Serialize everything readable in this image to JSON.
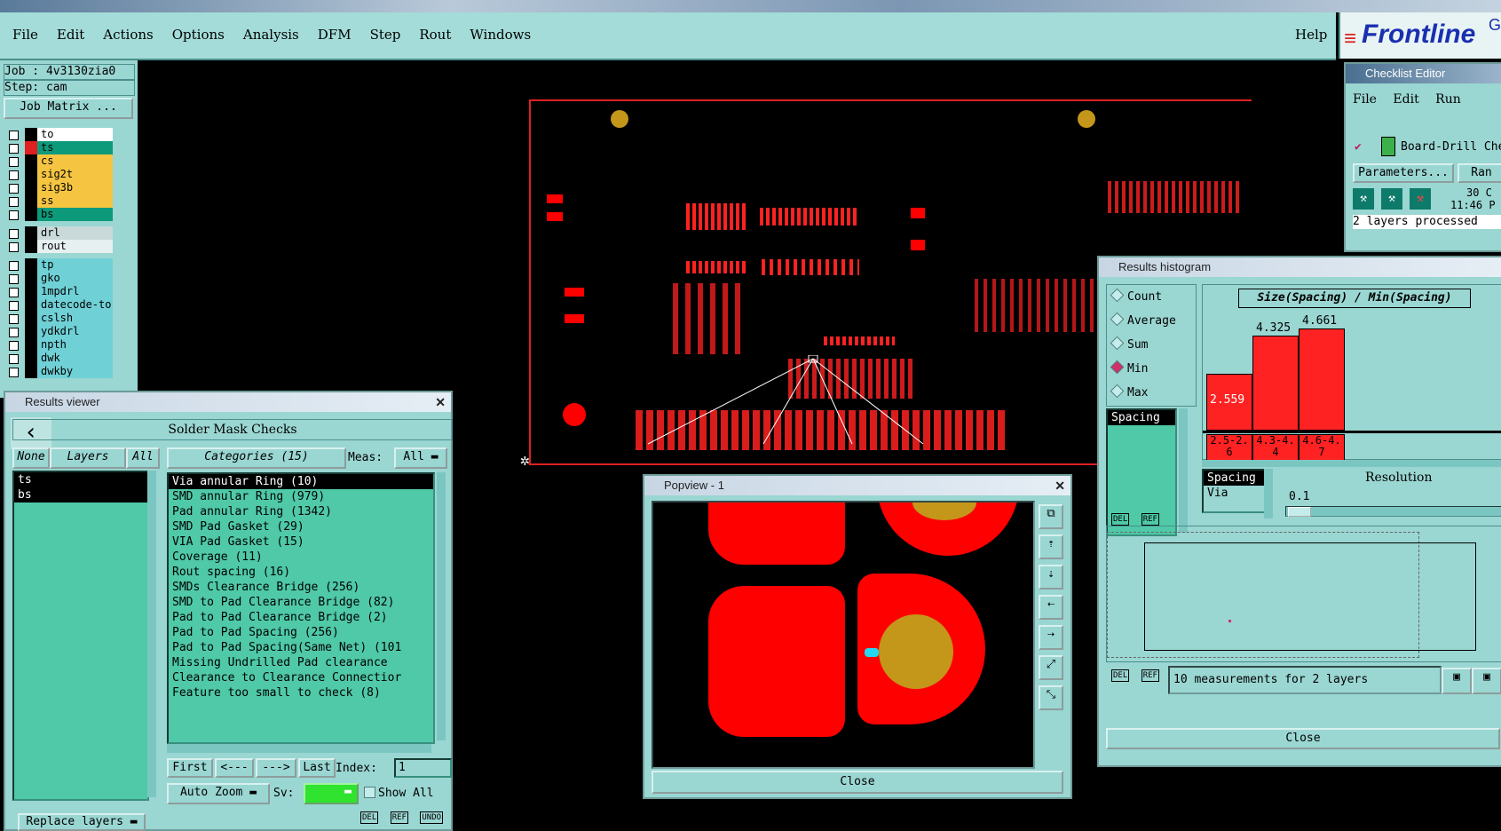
{
  "menubar": {
    "items": [
      "File",
      "Edit",
      "Actions",
      "Options",
      "Analysis",
      "DFM",
      "Step",
      "Rout",
      "Windows"
    ],
    "help": "Help",
    "logo": "Frontline",
    "logo_extra": "G"
  },
  "job": {
    "job_line": "Job : 4v3130zia0",
    "step_line": "Step: cam",
    "matrix_button": "Job Matrix ...",
    "layers": [
      {
        "name": "to",
        "color": "#ffffff"
      },
      {
        "name": "ts",
        "color": "#0d9a7a"
      },
      {
        "name": "cs",
        "color": "#f5c542"
      },
      {
        "name": "sig2t",
        "color": "#f5c542"
      },
      {
        "name": "sig3b",
        "color": "#f5c542"
      },
      {
        "name": "ss",
        "color": "#f5c542"
      },
      {
        "name": "bs",
        "color": "#0d9a7a"
      },
      {
        "name": "drl",
        "color": "#c9d9d9"
      },
      {
        "name": "rout",
        "color": "#e6f0f0"
      },
      {
        "name": "tp",
        "color": "#6fd0d6"
      },
      {
        "name": "gko",
        "color": "#6fd0d6"
      },
      {
        "name": "1mpdrl",
        "color": "#6fd0d6"
      },
      {
        "name": "datecode-to",
        "color": "#6fd0d6"
      },
      {
        "name": "cslsh",
        "color": "#6fd0d6"
      },
      {
        "name": "ydkdrl",
        "color": "#6fd0d6"
      },
      {
        "name": "npth",
        "color": "#6fd0d6"
      },
      {
        "name": "dwk",
        "color": "#6fd0d6"
      },
      {
        "name": "dwkby",
        "color": "#6fd0d6"
      }
    ]
  },
  "results_viewer": {
    "title": "Results viewer",
    "header": "Solder Mask Checks",
    "none_btn": "None",
    "layers_btn": "Layers",
    "all_btn": "All",
    "categories_btn": "Categories (15)",
    "meas_label": "Meas:",
    "meas_value": "All",
    "layers": [
      "ts",
      "bs"
    ],
    "categories": [
      "Via annular Ring (10)",
      "SMD annular Ring (979)",
      "Pad annular Ring (1342)",
      "SMD Pad Gasket (29)",
      "VIA Pad Gasket (15)",
      "Coverage (11)",
      "Rout spacing (16)",
      "SMDs Clearance Bridge (256)",
      "SMD to Pad Clearance Bridge (82)",
      "Pad to Pad Clearance Bridge (2)",
      "Pad to Pad Spacing (256)",
      "Pad to Pad Spacing(Same Net) (101",
      "Missing Undrilled Pad clearance",
      "Clearance to Clearance Connectior",
      "Feature too small to check (8)"
    ],
    "nav": {
      "first": "First",
      "prev": "<---",
      "next": "--->",
      "last": "Last",
      "index_label": "Index:",
      "index_value": "1"
    },
    "auto_zoom": "Auto Zoom",
    "sv_label": "Sv:",
    "show_all": "Show All",
    "replace_layers": "Replace layers",
    "bottom_icons": [
      "DEL",
      "REF",
      "UNDO"
    ]
  },
  "popview": {
    "title": "Popview - 1",
    "close": "Close"
  },
  "histogram": {
    "title": "Results histogram",
    "modes": [
      "Count",
      "Average",
      "Sum",
      "Min",
      "Max"
    ],
    "selected_mode": "Min",
    "chart_title": "Size(Spacing) / Min(Spacing)",
    "list_items": [
      "Spacing"
    ],
    "del": "DEL",
    "ref": "REF",
    "field_list": [
      "Spacing",
      "Via"
    ],
    "resolution_label": "Resolution",
    "resolution_value": "0.1",
    "status": "10 measurements for 2 layers",
    "close": "Close"
  },
  "chart_data": {
    "type": "bar",
    "title": "Size(Spacing) / Min(Spacing)",
    "categories": [
      "2.5-2.6",
      "4.3-4.4",
      "4.6-4.7"
    ],
    "values": [
      2.559,
      4.325,
      4.661
    ],
    "ylim": [
      0,
      5
    ]
  },
  "checklist": {
    "title": "Checklist Editor",
    "menu": [
      "File",
      "Edit",
      "Run"
    ],
    "item": "Board-Drill Che",
    "params_btn": "Parameters...",
    "ran_btn": "Ran",
    "date_line1": "30 C",
    "date_line2": "11:46 P",
    "status": "2 layers processed"
  }
}
